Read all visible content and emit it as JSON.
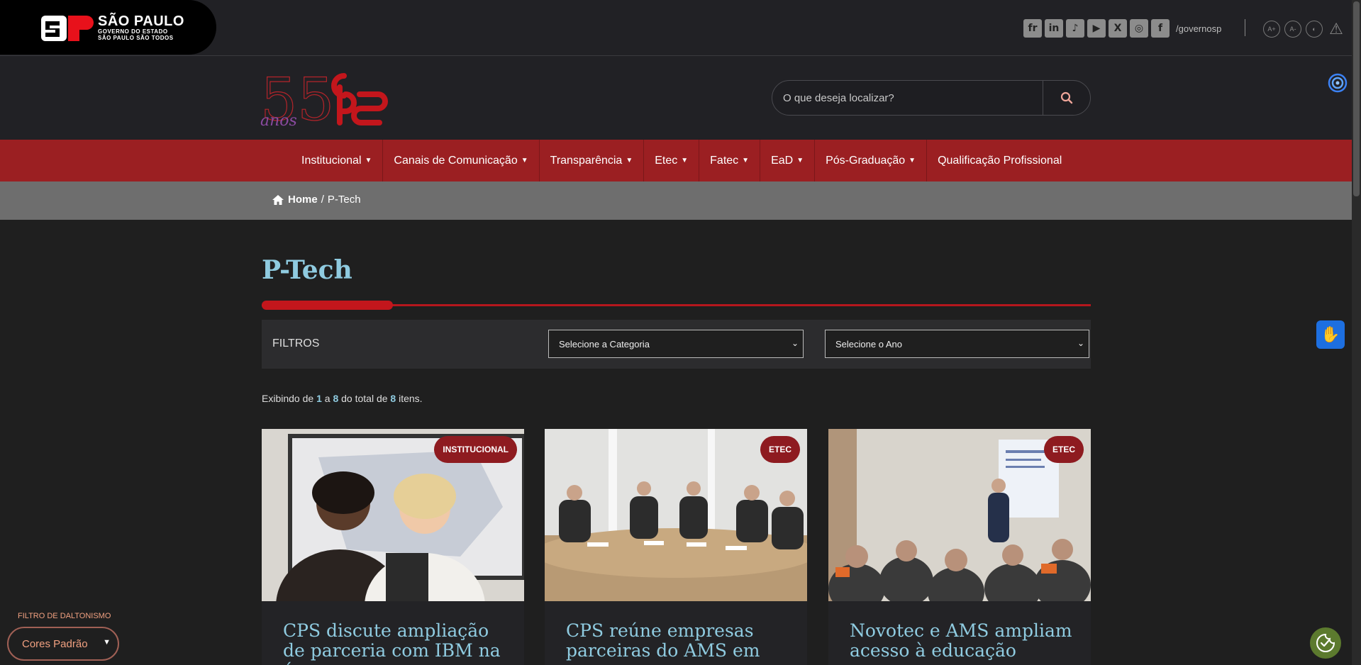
{
  "gov": {
    "title": "SÃO PAULO",
    "line2": "GOVERNO DO ESTADO",
    "line3": "SÃO PAULO SÃO TODOS",
    "social_handle": "/governosp",
    "socials": [
      "flickr-icon",
      "linkedin-icon",
      "tiktok-icon",
      "youtube-icon",
      "x-icon",
      "instagram-icon",
      "facebook-icon"
    ]
  },
  "header": {
    "logo_alt": "55 anos CPS",
    "search_placeholder": "O que deseja localizar?"
  },
  "nav": {
    "items": [
      {
        "label": "Institucional",
        "dropdown": true
      },
      {
        "label": "Canais de Comunicação",
        "dropdown": true
      },
      {
        "label": "Transparência",
        "dropdown": true
      },
      {
        "label": "Etec",
        "dropdown": true
      },
      {
        "label": "Fatec",
        "dropdown": true
      },
      {
        "label": "EaD",
        "dropdown": true
      },
      {
        "label": "Pós-Graduação",
        "dropdown": true
      },
      {
        "label": "Qualificação Profissional",
        "dropdown": false
      }
    ]
  },
  "breadcrumb": {
    "home": "Home",
    "separator": "/",
    "current": "P-Tech"
  },
  "page": {
    "title": "P-Tech"
  },
  "filters": {
    "label": "FILTROS",
    "category": "Selecione a Categoria",
    "year": "Selecione o Ano"
  },
  "count": {
    "prefix": "Exibindo de",
    "from": "1",
    "mid": "a",
    "to": "8",
    "mid2": "do total de",
    "total": "8",
    "suffix": "itens."
  },
  "cards": [
    {
      "badge": "INSTITUCIONAL",
      "title": "CPS discute ampliação de parceria com IBM na área"
    },
    {
      "badge": "ETEC",
      "title": "CPS reúne empresas parceiras do AMS em"
    },
    {
      "badge": "ETEC",
      "title": "Novotec e AMS ampliam acesso à educação"
    }
  ],
  "daltonismo": {
    "label": "FILTRO DE DALTONISMO",
    "value": "Cores Padrão"
  },
  "a11y": {
    "increase": "A+",
    "decrease": "A-"
  }
}
